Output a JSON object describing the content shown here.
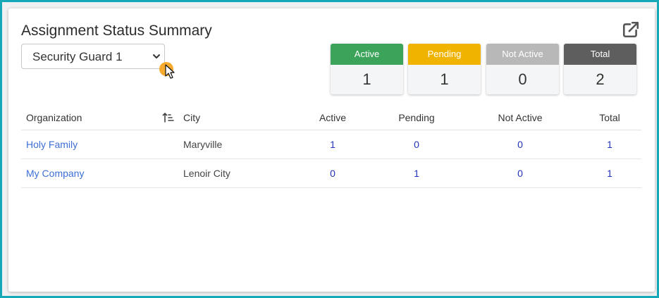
{
  "widget": {
    "title": "Assignment Status Summary",
    "export_icon": "external-link-icon"
  },
  "filter": {
    "selected": "Security Guard 1"
  },
  "stats": [
    {
      "label": "Active",
      "value": "1",
      "color": "#3ca45a"
    },
    {
      "label": "Pending",
      "value": "1",
      "color": "#f0b400"
    },
    {
      "label": "Not Active",
      "value": "0",
      "color": "#b8b8b8"
    },
    {
      "label": "Total",
      "value": "2",
      "color": "#5e5e5e"
    }
  ],
  "table": {
    "headers": {
      "organization": "Organization",
      "city": "City",
      "active": "Active",
      "pending": "Pending",
      "not_active": "Not Active",
      "total": "Total"
    },
    "rows": [
      {
        "organization": "Holy Family",
        "city": "Maryville",
        "active": "1",
        "pending": "0",
        "not_active": "0",
        "total": "1"
      },
      {
        "organization": "My Company",
        "city": "Lenoir City",
        "active": "0",
        "pending": "1",
        "not_active": "0",
        "total": "1"
      }
    ]
  }
}
